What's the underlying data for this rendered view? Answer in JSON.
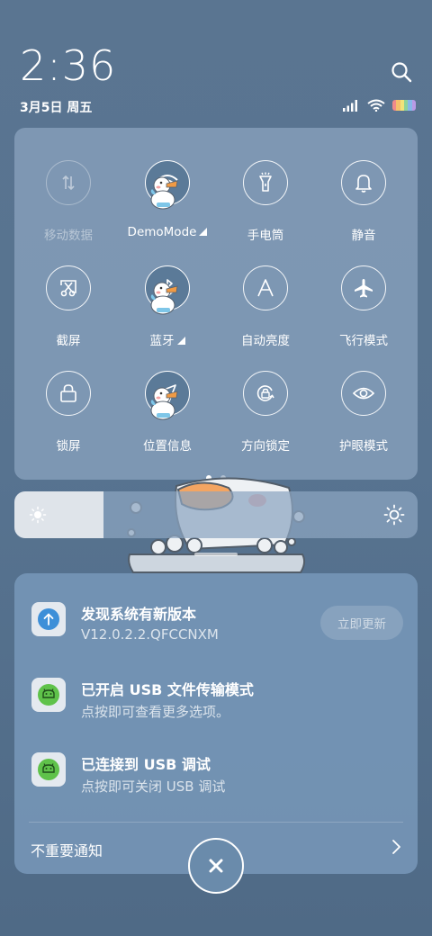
{
  "status_bar": {
    "time": "2:36",
    "date": "3月5日 周五",
    "icons": [
      "search-icon",
      "signal-icon",
      "wifi-icon",
      "battery-icon"
    ]
  },
  "quick_settings": {
    "tiles": [
      {
        "label": "移动数据",
        "icon": "mobile-data-icon",
        "state": "disabled"
      },
      {
        "label": "DemoMode",
        "icon": "wifi-icon",
        "state": "active",
        "expandable": true
      },
      {
        "label": "手电筒",
        "icon": "flashlight-icon",
        "state": "off"
      },
      {
        "label": "静音",
        "icon": "bell-icon",
        "state": "off"
      },
      {
        "label": "截屏",
        "icon": "screenshot-icon",
        "state": "off"
      },
      {
        "label": "蓝牙",
        "icon": "bluetooth-icon",
        "state": "active",
        "expandable": true
      },
      {
        "label": "自动亮度",
        "icon": "auto-brightness-icon",
        "state": "off"
      },
      {
        "label": "飞行模式",
        "icon": "airplane-icon",
        "state": "off"
      },
      {
        "label": "锁屏",
        "icon": "lock-icon",
        "state": "off"
      },
      {
        "label": "位置信息",
        "icon": "location-icon",
        "state": "active"
      },
      {
        "label": "方向锁定",
        "icon": "rotation-lock-icon",
        "state": "off"
      },
      {
        "label": "护眼模式",
        "icon": "eye-icon",
        "state": "off"
      }
    ],
    "page_count": 2,
    "current_page": 1
  },
  "brightness": {
    "level": 0.22
  },
  "notifications": {
    "items": [
      {
        "title": "发现系统有新版本",
        "subtitle": "V12.0.2.2.QFCCNXM",
        "action": "立即更新",
        "icon": "update-arrow-icon"
      },
      {
        "title": "已开启 USB 文件传输模式",
        "subtitle": "点按即可查看更多选项。",
        "icon": "android-icon"
      },
      {
        "title": "已连接到 USB 调试",
        "subtitle": "点按即可关闭 USB 调试",
        "icon": "android-icon"
      }
    ],
    "unimportant_label": "不重要通知"
  },
  "colors": {
    "accent_blue": "#3d8fd8",
    "android_green": "#5fc24a"
  }
}
